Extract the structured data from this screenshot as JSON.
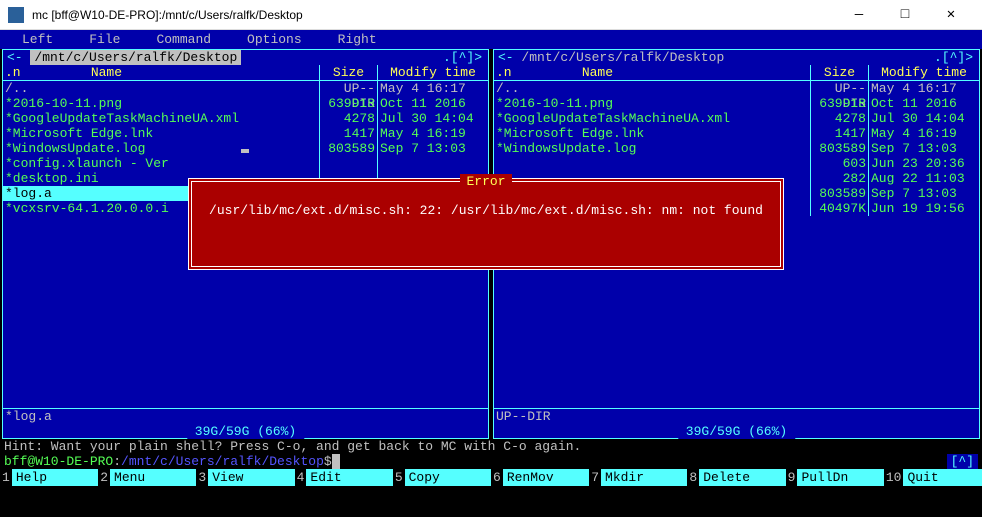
{
  "window": {
    "title": "mc [bff@W10-DE-PRO]:/mnt/c/Users/ralfk/Desktop"
  },
  "menubar": {
    "items": [
      "Left",
      "File",
      "Command",
      "Options",
      "Right"
    ]
  },
  "panels": {
    "left": {
      "path": "/mnt/c/Users/ralfk/Desktop",
      "marker": ".[^]>",
      "headers": {
        "name": ".n         Name",
        "size": "Size",
        "mtime": "Modify time"
      },
      "files": [
        {
          "name": "/..",
          "size": "UP--DIR",
          "mtime": "May  4 16:17",
          "type": "parent"
        },
        {
          "name": "*2016-10-11.png",
          "size": "639918",
          "mtime": "Oct 11  2016",
          "type": "exec"
        },
        {
          "name": "*GoogleUpdateTaskMachineUA.xml",
          "size": "4278",
          "mtime": "Jul 30 14:04",
          "type": "exec"
        },
        {
          "name": "*Microsoft Edge.lnk",
          "size": "1417",
          "mtime": "May  4 16:19",
          "type": "exec"
        },
        {
          "name": "*WindowsUpdate.log",
          "size": "803589",
          "mtime": "Sep  7 13:03",
          "type": "exec"
        },
        {
          "name": "*config.xlaunch - Ver",
          "size": "",
          "mtime": "",
          "type": "exec"
        },
        {
          "name": "*desktop.ini",
          "size": "",
          "mtime": "",
          "type": "exec"
        },
        {
          "name": "*log.a",
          "size": "",
          "mtime": "",
          "type": "selected"
        },
        {
          "name": "*vcxsrv-64.1.20.0.0.i",
          "size": "",
          "mtime": "",
          "type": "exec"
        }
      ],
      "footer": "*log.a",
      "status": "39G/59G (66%)"
    },
    "right": {
      "path": "/mnt/c/Users/ralfk/Desktop",
      "marker": ".[^]>",
      "arrow": "<-",
      "headers": {
        "name": ".n         Name",
        "size": "Size",
        "mtime": "Modify time"
      },
      "files": [
        {
          "name": "/..",
          "size": "UP--DIR",
          "mtime": "May  4 16:17",
          "type": "parent"
        },
        {
          "name": "*2016-10-11.png",
          "size": "639918",
          "mtime": "Oct 11  2016",
          "type": "exec"
        },
        {
          "name": "*GoogleUpdateTaskMachineUA.xml",
          "size": "4278",
          "mtime": "Jul 30 14:04",
          "type": "exec"
        },
        {
          "name": "*Microsoft Edge.lnk",
          "size": "1417",
          "mtime": "May  4 16:19",
          "type": "exec"
        },
        {
          "name": "*WindowsUpdate.log",
          "size": "803589",
          "mtime": "Sep  7 13:03",
          "type": "exec"
        },
        {
          "name": "",
          "size": "603",
          "mtime": "Jun 23 20:36",
          "type": "exec"
        },
        {
          "name": "",
          "size": "282",
          "mtime": "Aug 22 11:03",
          "type": "exec"
        },
        {
          "name": "",
          "size": "803589",
          "mtime": "Sep  7 13:03",
          "type": "exec"
        },
        {
          "name": "",
          "size": "40497K",
          "mtime": "Jun 19 19:56",
          "type": "exec"
        }
      ],
      "footer": "UP--DIR",
      "status": "39G/59G (66%)"
    }
  },
  "error": {
    "title": "Error",
    "message": "/usr/lib/mc/ext.d/misc.sh: 22: /usr/lib/mc/ext.d/misc.sh: nm: not found"
  },
  "hint": "Hint: Want your plain shell? Press C-o, and get back to MC with C-o again.",
  "prompt": {
    "user": "bff@W10-DE-PRO",
    "sep": ":",
    "path": "/mnt/c/Users/ralfk/Desktop",
    "suffix": "$",
    "indicator": "[^]"
  },
  "fkeys": [
    {
      "n": "1",
      "lbl": "Help"
    },
    {
      "n": "2",
      "lbl": "Menu"
    },
    {
      "n": "3",
      "lbl": "View"
    },
    {
      "n": "4",
      "lbl": "Edit"
    },
    {
      "n": "5",
      "lbl": "Copy"
    },
    {
      "n": "6",
      "lbl": "RenMov"
    },
    {
      "n": "7",
      "lbl": "Mkdir"
    },
    {
      "n": "8",
      "lbl": "Delete"
    },
    {
      "n": "9",
      "lbl": "PullDn"
    },
    {
      "n": "10",
      "lbl": "Quit"
    }
  ]
}
